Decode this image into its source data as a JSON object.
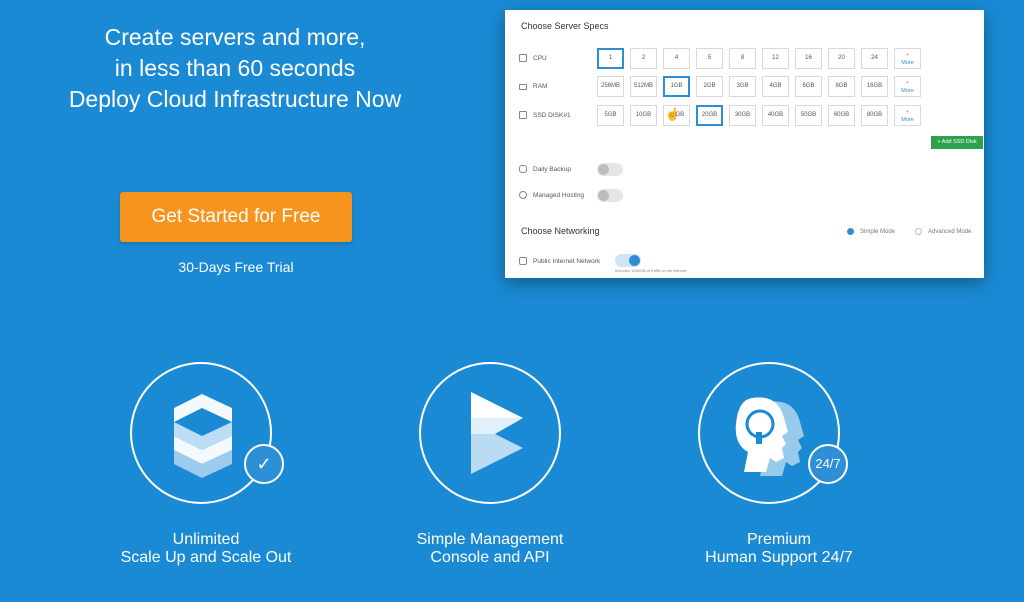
{
  "hero": {
    "line1": "Create servers and more,",
    "line2": "in less than 60 seconds",
    "line3": "Deploy Cloud Infrastructure Now",
    "cta_label": "Get Started for Free",
    "trial_label": "30-Days Free Trial"
  },
  "panel": {
    "title": "Choose Server Specs",
    "cpu": {
      "label": "CPU",
      "options": [
        "1",
        "2",
        "4",
        "5",
        "8",
        "12",
        "16",
        "20",
        "24"
      ],
      "selected": "1"
    },
    "ram": {
      "label": "RAM",
      "options": [
        "256MB",
        "512MB",
        "1GB",
        "2GB",
        "3GB",
        "4GB",
        "6GB",
        "8GB",
        "16GB"
      ],
      "selected": "1GB"
    },
    "disk": {
      "label": "SSD DISK#1",
      "options": [
        "5GB",
        "10GB",
        "15GB",
        "20GB",
        "30GB",
        "40GB",
        "50GB",
        "60GB",
        "80GB"
      ],
      "selected": "20GB"
    },
    "more_plus": "+",
    "more_label": "More",
    "add_disk_label": "+ Add SSD Disk",
    "daily_backup": "Daily Backup",
    "managed_hosting": "Managed Hosting",
    "networking_title": "Choose Networking",
    "simple_mode": "Simple Mode",
    "advanced_mode": "Advanced Mode",
    "public_network": "Public Internet Network",
    "public_network_hint": "Includes 1000GB of traffic to the internet"
  },
  "features": [
    {
      "line1": "Unlimited",
      "line2": "Scale Up and Scale Out",
      "badge": "✓"
    },
    {
      "line1": "Simple Management",
      "line2": "Console and API"
    },
    {
      "line1": "Premium",
      "line2": "Human Support 24/7",
      "badge": "24/7"
    }
  ],
  "colors": {
    "background": "#1a8ad4",
    "cta": "#f7941d",
    "accent": "#2e8fd0",
    "add_disk": "#2ca24c"
  }
}
